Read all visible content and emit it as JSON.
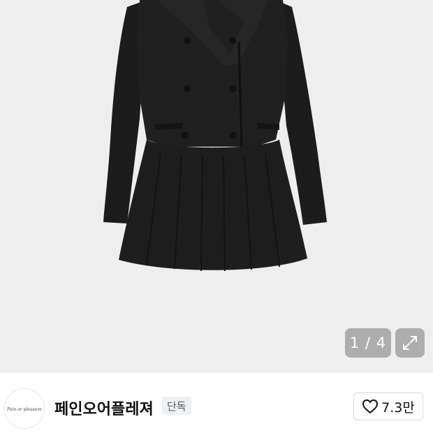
{
  "gallery": {
    "image_alt": "black double-breasted mini dress",
    "counter": "1 / 4",
    "expand_icon": "expand-icon"
  },
  "seller": {
    "avatar_text": "Pain or pleasure",
    "name": "페인오어플레져",
    "badge": "단독",
    "like_count": "7.3만",
    "like_icon": "heart-outline-icon"
  },
  "colors": {
    "gallery_bg": "#eeeeee",
    "badge_bg": "#eef1f4",
    "text_primary": "#111111"
  }
}
